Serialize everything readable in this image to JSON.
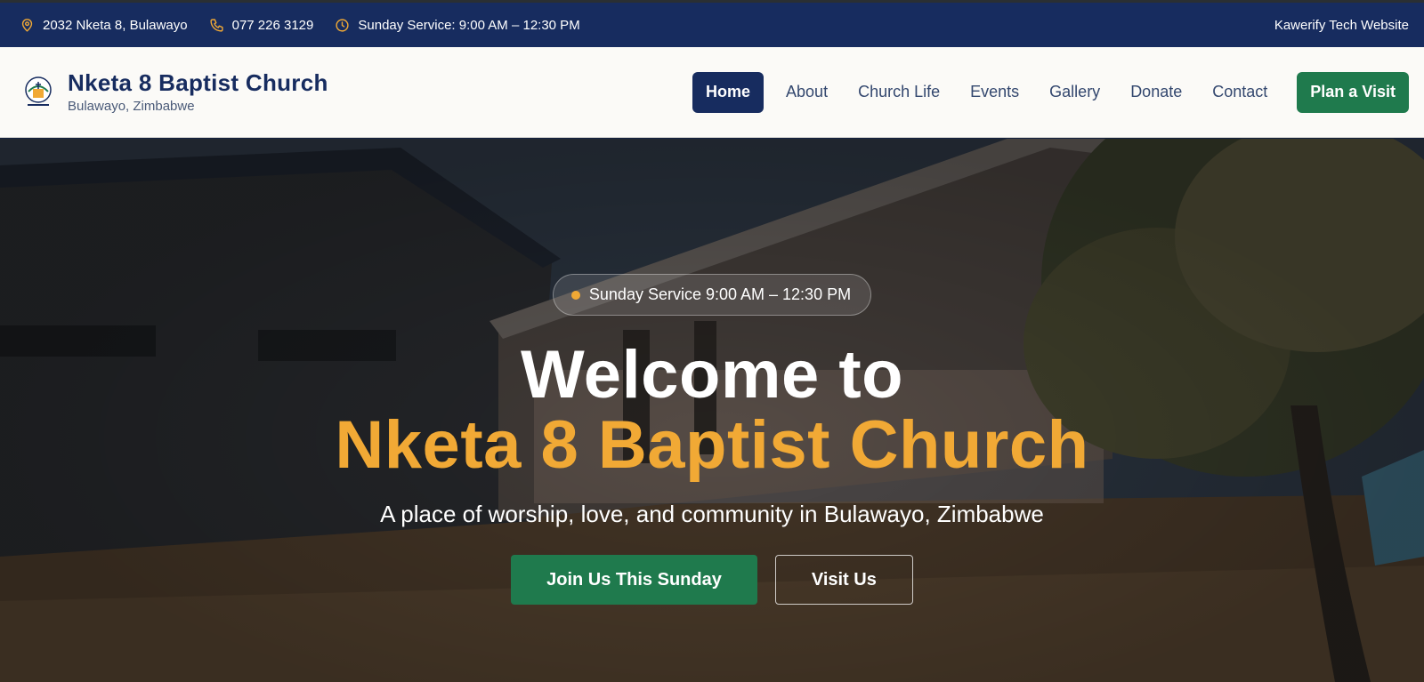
{
  "topbar": {
    "address": "2032 Nketa 8, Bulawayo",
    "phone": "077 226 3129",
    "service": "Sunday Service: 9:00 AM – 12:30 PM",
    "credit": "Kawerify Tech Website",
    "icons": [
      "location-pin-icon",
      "phone-icon",
      "clock-icon"
    ],
    "icon_color": "#f1a935"
  },
  "brand": {
    "name": "Nketa 8 Baptist Church",
    "location": "Bulawayo, Zimbabwe"
  },
  "nav": {
    "items": [
      {
        "label": "Home",
        "active": true
      },
      {
        "label": "About",
        "active": false
      },
      {
        "label": "Church Life",
        "active": false
      },
      {
        "label": "Events",
        "active": false
      },
      {
        "label": "Gallery",
        "active": false
      },
      {
        "label": "Donate",
        "active": false
      },
      {
        "label": "Contact",
        "active": false
      }
    ],
    "cta": "Plan a Visit"
  },
  "hero": {
    "pill": "Sunday Service 9:00 AM – 12:30 PM",
    "title_line1": "Welcome to",
    "title_line2": "Nketa 8 Baptist Church",
    "subtitle": "A place of worship, love, and community in Bulawayo, Zimbabwe",
    "primary_button": "Join Us This Sunday",
    "secondary_button": "Visit Us"
  },
  "colors": {
    "navy": "#172c5f",
    "gold": "#f1a935",
    "green": "#1f7a4d"
  }
}
